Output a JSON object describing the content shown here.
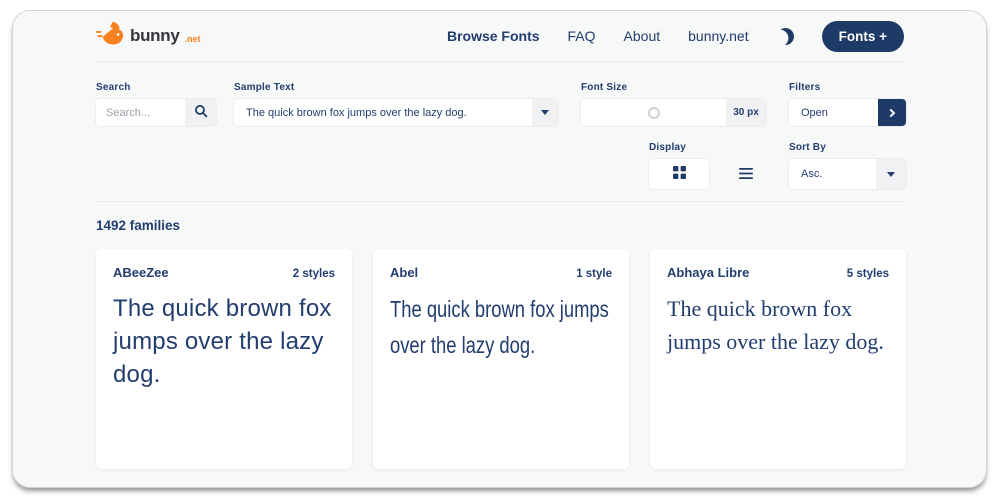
{
  "header": {
    "logo": {
      "brand": "bunny",
      "tld": ".net"
    },
    "nav": [
      {
        "label": "Browse Fonts",
        "active": true
      },
      {
        "label": "FAQ",
        "active": false
      },
      {
        "label": "About",
        "active": false
      },
      {
        "label": "bunny.net",
        "active": false
      }
    ],
    "fonts_button_label": "Fonts +"
  },
  "filters": {
    "search": {
      "label": "Search",
      "placeholder": "Search..."
    },
    "sample_text": {
      "label": "Sample Text",
      "value": "The quick brown fox jumps over the lazy dog."
    },
    "font_size": {
      "label": "Font Size",
      "value": "30 px"
    },
    "filters_panel": {
      "label": "Filters",
      "value": "Open"
    },
    "display": {
      "label": "Display"
    },
    "sort_by": {
      "label": "Sort By",
      "value": "Asc."
    }
  },
  "results": {
    "count_text": "1492 families",
    "cards": [
      {
        "name": "ABeeZee",
        "styles": "2 styles",
        "sample": "The quick brown fox jumps over the lazy dog."
      },
      {
        "name": "Abel",
        "styles": "1 style",
        "sample": "The quick brown fox jumps over the lazy dog."
      },
      {
        "name": "Abhaya Libre",
        "styles": "5 styles",
        "sample": "The quick brown fox jumps over the lazy dog."
      }
    ]
  },
  "icons": {
    "logo": "bunny-logo-icon",
    "theme": "moon-icon",
    "search": "search-icon",
    "sample_caret": "caret-down-icon",
    "filters_chevron": "chevron-right-icon",
    "grid": "grid-view-icon",
    "list": "list-view-icon",
    "sort_caret": "caret-down-icon"
  },
  "colors": {
    "navy": "#223d6e",
    "navy_button": "#1e3a66",
    "orange": "#f5821f",
    "page_bg": "#f7f8f8"
  }
}
